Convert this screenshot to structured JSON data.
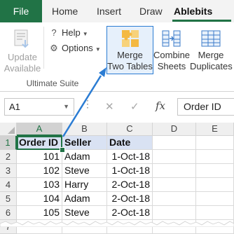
{
  "ribbon_tabs": {
    "file": "File",
    "home": "Home",
    "insert": "Insert",
    "draw": "Draw",
    "ablebits": "Ablebits Data"
  },
  "ribbon": {
    "update_available": [
      "Update",
      "Available"
    ],
    "help": "Help",
    "options": "Options",
    "group_label": "Ultimate Suite",
    "merge_two_tables": [
      "Merge",
      "Two Tables"
    ],
    "combine_sheets": [
      "Combine",
      "Sheets"
    ],
    "merge_duplicates": [
      "Merge",
      "Duplicates"
    ]
  },
  "formula_bar": {
    "name_box": "A1",
    "fx": "fx",
    "formula": "Order ID"
  },
  "sheet": {
    "columns": [
      "A",
      "B",
      "C",
      "D",
      "E"
    ],
    "rows": [
      "1",
      "2",
      "3",
      "4",
      "5",
      "6",
      "7"
    ],
    "header": [
      "Order ID",
      "Seller",
      "Date"
    ],
    "data": [
      [
        "101",
        "Adam",
        "1-Oct-18"
      ],
      [
        "102",
        "Steve",
        "1-Oct-18"
      ],
      [
        "103",
        "Harry",
        "2-Oct-18"
      ],
      [
        "104",
        "Adam",
        "2-Oct-18"
      ],
      [
        "105",
        "Steve",
        "2-Oct-18"
      ]
    ]
  },
  "colors": {
    "excel_green": "#217346",
    "highlight_blue": "#2b7cd3",
    "header_fill": "#d9e2f3"
  }
}
